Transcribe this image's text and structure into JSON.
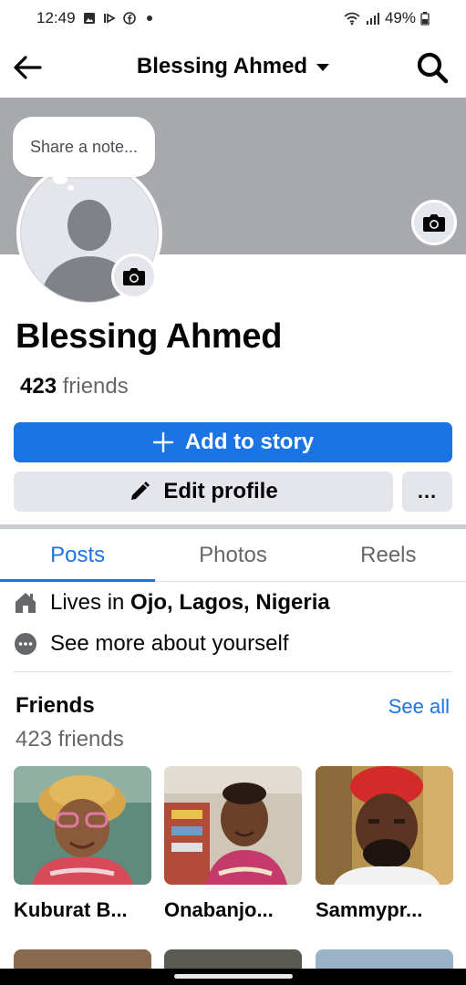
{
  "status_bar": {
    "time": "12:49",
    "battery": "49%",
    "icons": [
      "gallery-icon",
      "cast-icon",
      "facebook-icon",
      "dot-icon",
      "wifi-icon",
      "signal-icon",
      "battery-icon"
    ]
  },
  "app_bar": {
    "title": "Blessing Ahmed",
    "back_icon": "arrow-left-icon",
    "search_icon": "search-icon"
  },
  "note": {
    "placeholder": "Share a note..."
  },
  "profile": {
    "name": "Blessing Ahmed",
    "friends_number": "423",
    "friends_word": " friends"
  },
  "actions": {
    "add_story": "Add to story",
    "edit_profile": "Edit profile",
    "more": "..."
  },
  "tabs": [
    {
      "label": "Posts",
      "active": true
    },
    {
      "label": "Photos",
      "active": false
    },
    {
      "label": "Reels",
      "active": false
    }
  ],
  "about": {
    "lives_prefix": "Lives in ",
    "lives_location": "Ojo, Lagos, Nigeria",
    "see_more": "See more about yourself"
  },
  "friends_section": {
    "title": "Friends",
    "see_all": "See all",
    "count_text": "423 friends",
    "friends": [
      {
        "name": "Kuburat B..."
      },
      {
        "name": "Onabanjo..."
      },
      {
        "name": "Sammypr..."
      }
    ]
  },
  "colors": {
    "accent": "#1b74e4",
    "cover": "#a8a9ac",
    "secondary_button": "#e4e6eb"
  }
}
